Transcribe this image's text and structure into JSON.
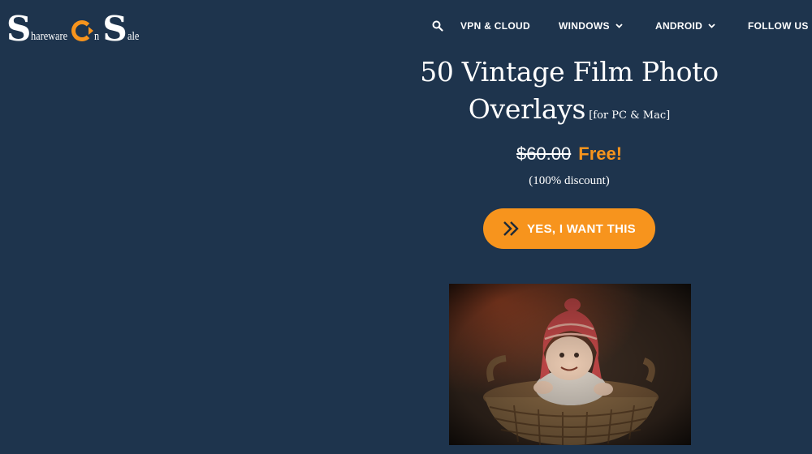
{
  "logo": {
    "letter_s1": "S",
    "word_hareware": "hareware",
    "letter_o": "O",
    "word_n": "n",
    "letter_s2": "S",
    "word_ale": "ale",
    "icon": "power-ring-icon",
    "accent": "#f7941d"
  },
  "nav": {
    "search_icon": "search-icon",
    "items": [
      {
        "label": "VPN & CLOUD",
        "has_dropdown": false
      },
      {
        "label": "WINDOWS",
        "has_dropdown": true
      },
      {
        "label": "ANDROID",
        "has_dropdown": true
      },
      {
        "label": "FOLLOW US",
        "has_dropdown": false
      }
    ]
  },
  "product": {
    "title": "50 Vintage Film Photo Overlays",
    "platform": "[for PC & Mac]",
    "old_price": "$60.00",
    "new_price": "Free!",
    "discount": "(100% discount)",
    "cta_label": "YES, I WANT THIS",
    "cta_icon": "double-chevron-right-icon"
  },
  "colors": {
    "background": "#1e344d",
    "accent": "#f7941d",
    "text": "#ffffff"
  }
}
